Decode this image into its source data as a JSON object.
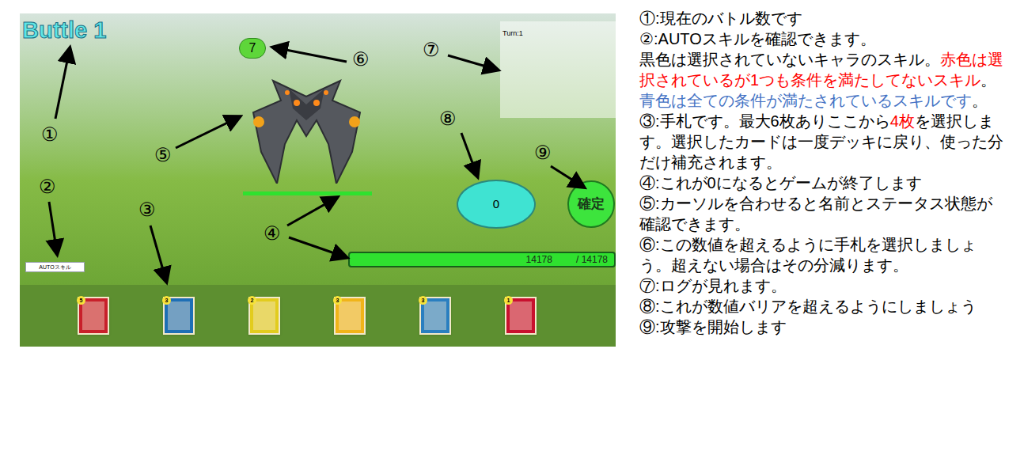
{
  "game": {
    "battle_title": "Buttle 1",
    "barrier_value": "7",
    "log": {
      "text": "Turn:1"
    },
    "attack_value": "0",
    "confirm_button": "確定",
    "auto_skill_button": "AUTOスキル",
    "enemy_hp": {
      "level": 1
    },
    "player_hp": {
      "current": "14178",
      "separator": "/",
      "max": "14178",
      "level": 1
    },
    "hand": [
      {
        "cost": "5",
        "color": "#c8202a"
      },
      {
        "cost": "3",
        "color": "#1e6fb5"
      },
      {
        "cost": "2",
        "color": "#e2cc1e"
      },
      {
        "cost": "3",
        "color": "#f0b419"
      },
      {
        "cost": "3",
        "color": "#2a7fc0"
      },
      {
        "cost": "1",
        "color": "#c8102e"
      }
    ],
    "annotations": [
      {
        "label": "①"
      },
      {
        "label": "②"
      },
      {
        "label": "③"
      },
      {
        "label": "④"
      },
      {
        "label": "⑤"
      },
      {
        "label": "⑥"
      },
      {
        "label": "⑦"
      },
      {
        "label": "⑧"
      },
      {
        "label": "⑨"
      }
    ]
  },
  "explanations": [
    {
      "paragraphs": [
        [
          {
            "text": "①:現在のバトル数です",
            "color": "#000000"
          }
        ]
      ]
    },
    {
      "paragraphs": [
        [
          {
            "text": "②:AUTOスキルを確認できます。",
            "color": "#000000"
          }
        ],
        [
          {
            "text": "黒色は選択されていないキャラのスキル。",
            "color": "#000000"
          },
          {
            "text": "赤色は選択されているが1つも条件を満たしてないスキル",
            "color": "#ff0000"
          },
          {
            "text": "。",
            "color": "#000000"
          },
          {
            "text": "青色は全ての条件が満たされているスキルです",
            "color": "#4472c4"
          },
          {
            "text": "。",
            "color": "#000000"
          }
        ]
      ]
    },
    {
      "paragraphs": [
        [
          {
            "text": "③:手札です。最大6枚ありここから",
            "color": "#000000"
          },
          {
            "text": "4枚",
            "color": "#ff0000"
          },
          {
            "text": "を選択します。選択したカードは一度デッキに戻り、使った分だけ補充されます。",
            "color": "#000000"
          }
        ]
      ]
    },
    {
      "paragraphs": [
        [
          {
            "text": "④:これが0になるとゲームが終了します",
            "color": "#000000"
          }
        ]
      ]
    },
    {
      "paragraphs": [
        [
          {
            "text": "⑤:カーソルを合わせると名前とステータス状態が確認できます。",
            "color": "#000000"
          }
        ]
      ]
    },
    {
      "paragraphs": [
        [
          {
            "text": "⑥:この数値を超えるように手札を選択しましょう。超えない場合はその分減ります。",
            "color": "#000000"
          }
        ]
      ]
    },
    {
      "paragraphs": [
        [
          {
            "text": "⑦:ログが見れます。",
            "color": "#000000"
          }
        ]
      ]
    },
    {
      "paragraphs": [
        [
          {
            "text": "⑧:これが数値バリアを超えるようにしましょう",
            "color": "#000000"
          }
        ]
      ]
    },
    {
      "paragraphs": [
        [
          {
            "text": "⑨:攻撃を開始します",
            "color": "#000000"
          }
        ]
      ]
    }
  ]
}
